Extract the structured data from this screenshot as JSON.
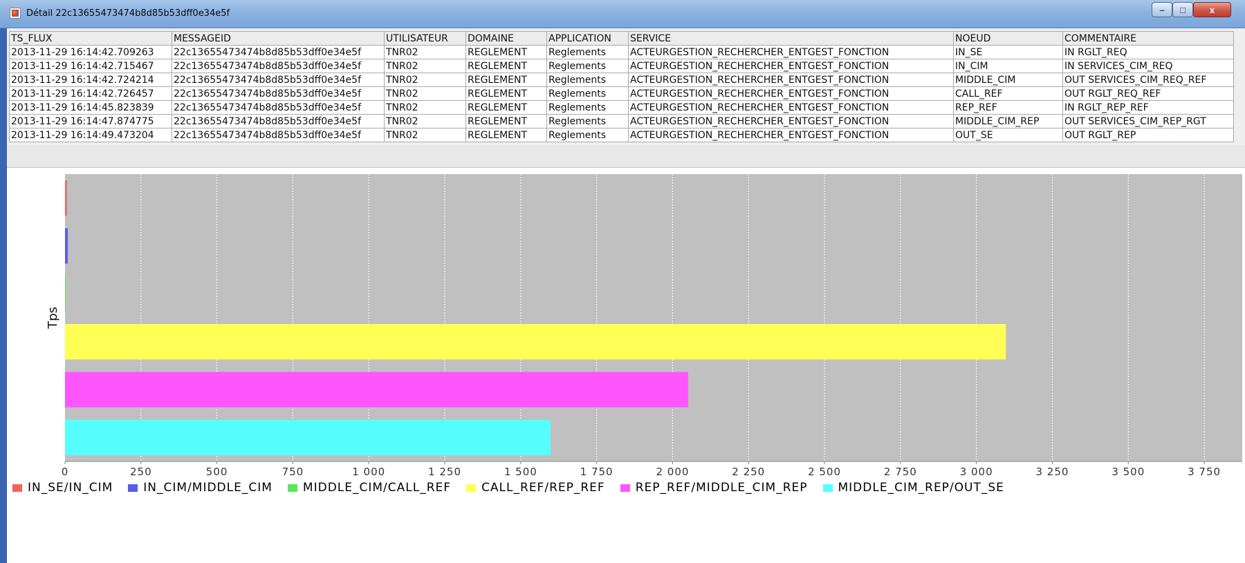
{
  "window": {
    "title": "Détail 22c13655473474b8d85b53dff0e34e5f",
    "buttons": {
      "minimize": "–",
      "maximize": "□",
      "close": "x"
    }
  },
  "table": {
    "columns": [
      "TS_FLUX",
      "MESSAGEID",
      "UTILISATEUR",
      "DOMAINE",
      "APPLICATION",
      "SERVICE",
      "NOEUD",
      "COMMENTAIRE"
    ],
    "rows": [
      [
        "2013-11-29 16:14:42.709263",
        "22c13655473474b8d85b53dff0e34e5f",
        "TNR02",
        "REGLEMENT",
        "Reglements",
        "ACTEURGESTION_RECHERCHER_ENTGEST_FONCTION",
        "IN_SE",
        "IN RGLT_REQ"
      ],
      [
        "2013-11-29 16:14:42.715467",
        "22c13655473474b8d85b53dff0e34e5f",
        "TNR02",
        "REGLEMENT",
        "Reglements",
        "ACTEURGESTION_RECHERCHER_ENTGEST_FONCTION",
        "IN_CIM",
        "IN SERVICES_CIM_REQ"
      ],
      [
        "2013-11-29 16:14:42.724214",
        "22c13655473474b8d85b53dff0e34e5f",
        "TNR02",
        "REGLEMENT",
        "Reglements",
        "ACTEURGESTION_RECHERCHER_ENTGEST_FONCTION",
        "MIDDLE_CIM",
        "OUT SERVICES_CIM_REQ_REF"
      ],
      [
        "2013-11-29 16:14:42.726457",
        "22c13655473474b8d85b53dff0e34e5f",
        "TNR02",
        "REGLEMENT",
        "Reglements",
        "ACTEURGESTION_RECHERCHER_ENTGEST_FONCTION",
        "CALL_REF",
        "OUT RGLT_REQ_REF"
      ],
      [
        "2013-11-29 16:14:45.823839",
        "22c13655473474b8d85b53dff0e34e5f",
        "TNR02",
        "REGLEMENT",
        "Reglements",
        "ACTEURGESTION_RECHERCHER_ENTGEST_FONCTION",
        "REP_REF",
        "IN RGLT_REP_REF"
      ],
      [
        "2013-11-29 16:14:47.874775",
        "22c13655473474b8d85b53dff0e34e5f",
        "TNR02",
        "REGLEMENT",
        "Reglements",
        "ACTEURGESTION_RECHERCHER_ENTGEST_FONCTION",
        "MIDDLE_CIM_REP",
        "OUT SERVICES_CIM_REP_RGT"
      ],
      [
        "2013-11-29 16:14:49.473204",
        "22c13655473474b8d85b53dff0e34e5f",
        "TNR02",
        "REGLEMENT",
        "Reglements",
        "ACTEURGESTION_RECHERCHER_ENTGEST_FONCTION",
        "OUT_SE",
        "OUT RGLT_REP"
      ]
    ]
  },
  "chart_data": {
    "type": "bar",
    "orientation": "horizontal",
    "title": "",
    "xlabel": "",
    "ylabel": "Tps",
    "xlim": [
      0,
      3875
    ],
    "xticks": [
      0,
      250,
      500,
      750,
      1000,
      1250,
      1500,
      1750,
      2000,
      2250,
      2500,
      2750,
      3000,
      3250,
      3500,
      3750
    ],
    "xtick_labels": [
      "0",
      "250",
      "500",
      "750",
      "1 000",
      "1 250",
      "1 500",
      "1 750",
      "2 000",
      "2 250",
      "2 500",
      "2 750",
      "3 000",
      "3 250",
      "3 500",
      "3 750"
    ],
    "grid": true,
    "legend_position": "bottom",
    "series": [
      {
        "name": "IN_SE/IN_CIM",
        "value": 6,
        "color": "#f45f5f"
      },
      {
        "name": "IN_CIM/MIDDLE_CIM",
        "value": 9,
        "color": "#5a5cf0"
      },
      {
        "name": "MIDDLE_CIM/CALL_REF",
        "value": 2,
        "color": "#5ae65a"
      },
      {
        "name": "CALL_REF/REP_REF",
        "value": 3097,
        "color": "#ffff55"
      },
      {
        "name": "REP_REF/MIDDLE_CIM_REP",
        "value": 2051,
        "color": "#ff55ff"
      },
      {
        "name": "MIDDLE_CIM_REP/OUT_SE",
        "value": 1598,
        "color": "#55ffff"
      }
    ]
  }
}
